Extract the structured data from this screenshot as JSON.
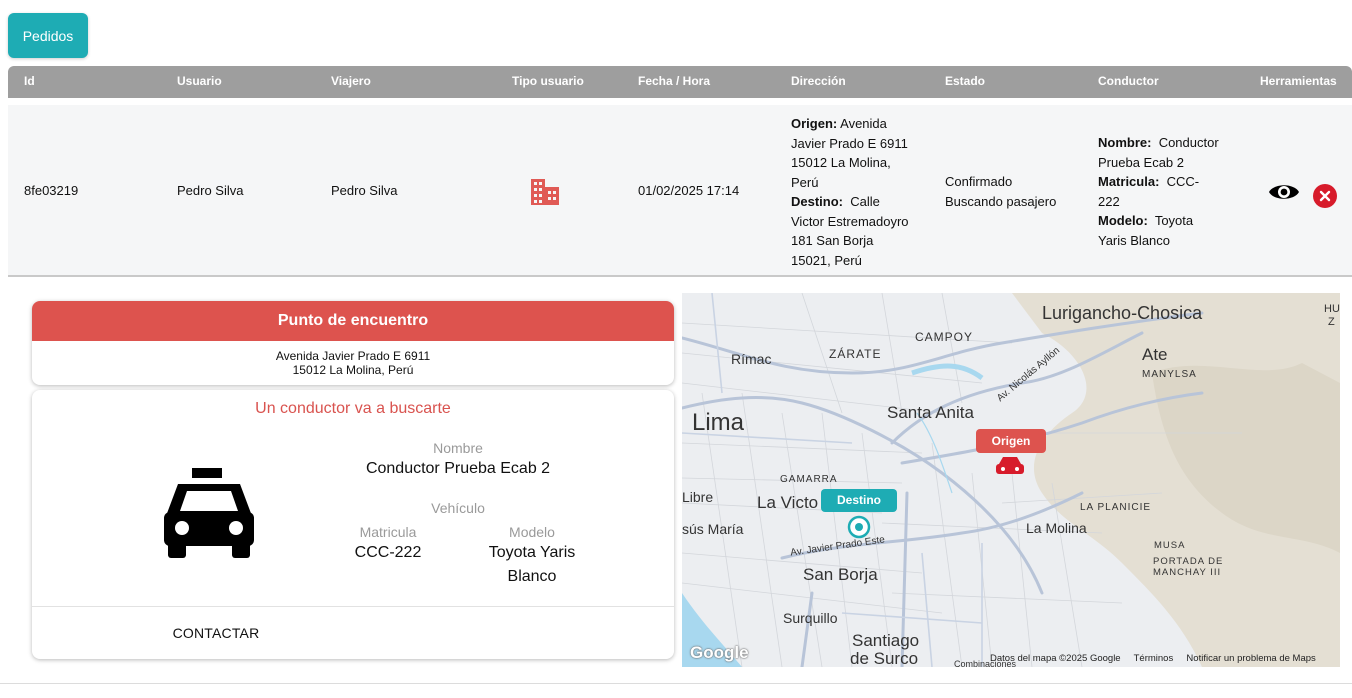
{
  "tabs": {
    "pedidos": "Pedidos"
  },
  "table": {
    "headers": {
      "id": "Id",
      "usuario": "Usuario",
      "viajero": "Viajero",
      "tipo": "Tipo usuario",
      "fecha": "Fecha / Hora",
      "direccion": "Dirección",
      "estado": "Estado",
      "conductor": "Conductor",
      "herramientas": "Herramientas"
    },
    "row": {
      "id": "8fe03219",
      "usuario": "Pedro Silva",
      "viajero": "Pedro Silva",
      "tipo_icon": "building-icon",
      "fecha": "01/02/2025 17:14",
      "origen_label": "Origen:",
      "origen_1": "Avenida",
      "origen_2": "Javier Prado E 6911",
      "origen_3": "15012 La Molina,",
      "origen_4": "Perú",
      "destino_label": "Destino:",
      "destino_1": "Calle",
      "destino_2": "Victor Estremadoyro",
      "destino_3": "181 San Borja",
      "destino_4": "15021, Perú",
      "estado_1": "Confirmado",
      "estado_2": "Buscando pasajero",
      "nombre_label": "Nombre:",
      "nombre_1": "Conductor",
      "nombre_2": "Prueba Ecab 2",
      "matricula_label": "Matricula:",
      "matricula_1": "CCC-",
      "matricula_2": "222",
      "modelo_label": "Modelo:",
      "modelo_1": "Toyota",
      "modelo_2": "Yaris Blanco"
    }
  },
  "meeting": {
    "title": "Punto de encuentro",
    "address_1": "Avenida Javier Prado E 6911",
    "address_2": "15012 La Molina, Perú"
  },
  "driver": {
    "title": "Un conductor va a buscarte",
    "nombre_label": "Nombre",
    "nombre_value": "Conductor Prueba Ecab 2",
    "vehiculo_label": "Vehículo",
    "matricula_label": "Matricula",
    "matricula_value": "CCC-222",
    "modelo_label": "Modelo",
    "modelo_value_1": "Toyota Yaris",
    "modelo_value_2": "Blanco",
    "contact_label": "CONTACTAR"
  },
  "map": {
    "labels": {
      "lurigancho": "Lurigancho-Chosica",
      "campoy": "CAMPOY",
      "rimac": "Rímac",
      "zarate": "ZÁRATE",
      "ate": "Ate",
      "manylsa": "MANYLSA",
      "lima": "Lima",
      "santa_anita": "Santa Anita",
      "av_ayllon": "Av. Nicolás Ayllón",
      "gamarra": "GAMARRA",
      "libre": "Libre",
      "la_victoria": "La Victo",
      "jesus_maria": "sús María",
      "la_planicie": "LA PLANICIE",
      "la_molina": "La Molina",
      "musa": "MUSA",
      "portada_1": "PORTADA DE",
      "portada_2": "MANCHAY III",
      "av_javier": "Av. Javier Prado Este",
      "san_borja": "San Borja",
      "surquillo": "Surquillo",
      "santiago_1": "Santiago",
      "santiago_2": "de Surco",
      "hu": "HU",
      "z": "Z",
      "combinaciones": "Combinaciones"
    },
    "origen_marker": "Origen",
    "destino_marker": "Destino",
    "google": "Google",
    "footer": {
      "datos": "Datos del mapa ©2025 Google",
      "terminos": "Términos",
      "notificar": "Notificar un problema de Maps"
    }
  },
  "colors": {
    "teal": "#1eacb4",
    "red": "#dd534e",
    "header_gray": "#9e9e9e"
  }
}
